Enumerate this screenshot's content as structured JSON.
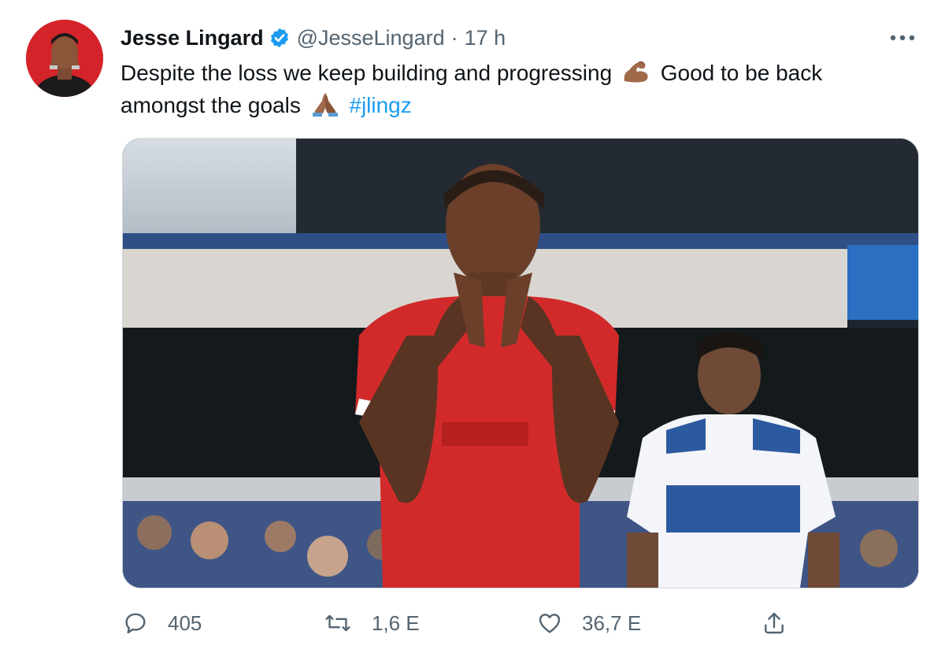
{
  "author": {
    "name": "Jesse Lingard",
    "handle": "@JesseLingard",
    "separator": "·",
    "time": "17 h"
  },
  "tweet": {
    "text_part1": "Despite the loss we keep building and progressing",
    "text_part2": "Good to be back amongst the goals",
    "hashtag": "#jlingz",
    "emoji1": "flexed-biceps-icon",
    "emoji2": "folded-hands-icon"
  },
  "actions": {
    "replies": "405",
    "retweets": "1,6 E",
    "likes": "36,7 E"
  },
  "icons": [
    "more-icon",
    "verified-badge-icon",
    "reply-icon",
    "retweet-icon",
    "like-icon",
    "share-icon"
  ],
  "colors": {
    "verified": "#1d9bf0",
    "hashtag": "#1d9bf0",
    "secondary_text": "#536471",
    "avatar_bg": "#d4242a",
    "jersey_red": "#d22a2a"
  }
}
